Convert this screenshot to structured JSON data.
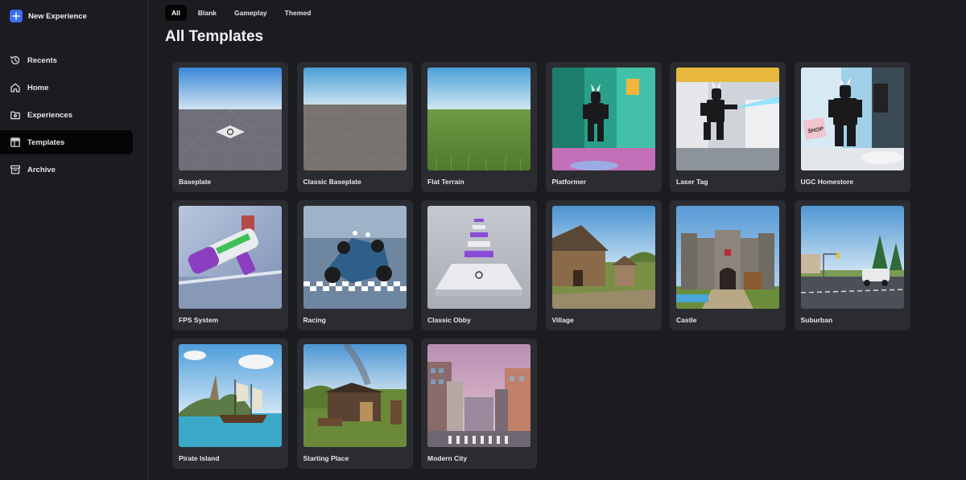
{
  "sidebar": {
    "new_experience": "New Experience",
    "items": [
      {
        "label": "Recents",
        "icon": "history-icon"
      },
      {
        "label": "Home",
        "icon": "home-icon"
      },
      {
        "label": "Experiences",
        "icon": "folder-icon"
      },
      {
        "label": "Templates",
        "icon": "template-icon",
        "active": true
      },
      {
        "label": "Archive",
        "icon": "archive-icon"
      }
    ]
  },
  "filters": [
    {
      "label": "All",
      "active": true
    },
    {
      "label": "Blank"
    },
    {
      "label": "Gameplay"
    },
    {
      "label": "Themed"
    }
  ],
  "main": {
    "title": "All Templates"
  },
  "templates": [
    {
      "name": "Baseplate",
      "scene": "baseplate"
    },
    {
      "name": "Classic Baseplate",
      "scene": "classic"
    },
    {
      "name": "Flat Terrain",
      "scene": "terrain"
    },
    {
      "name": "Platformer",
      "scene": "platformer"
    },
    {
      "name": "Laser Tag",
      "scene": "lasertag"
    },
    {
      "name": "UGC Homestore",
      "scene": "ugc"
    },
    {
      "name": "FPS System",
      "scene": "fps"
    },
    {
      "name": "Racing",
      "scene": "racing"
    },
    {
      "name": "Classic Obby",
      "scene": "obby"
    },
    {
      "name": "Village",
      "scene": "village"
    },
    {
      "name": "Castle",
      "scene": "castle"
    },
    {
      "name": "Suburban",
      "scene": "suburban"
    },
    {
      "name": "Pirate Island",
      "scene": "pirate"
    },
    {
      "name": "Starting Place",
      "scene": "starting"
    },
    {
      "name": "Modern City",
      "scene": "city"
    }
  ],
  "colors": {
    "accent": "#3a6df0",
    "background": "#1b1c20",
    "card": "#2b2c31",
    "active": "#050506"
  }
}
